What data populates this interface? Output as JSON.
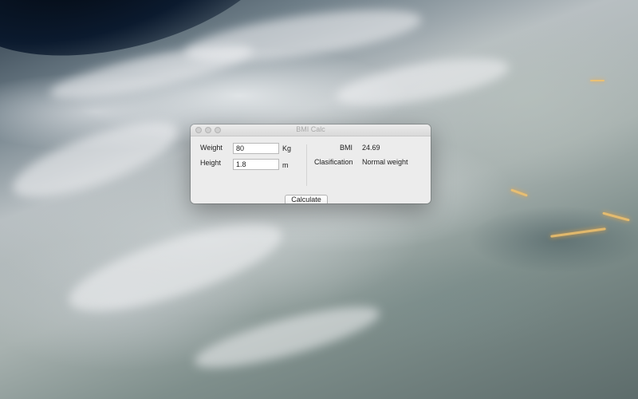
{
  "window": {
    "title": "BMI Calc"
  },
  "form": {
    "weight_label": "Weight",
    "weight_value": "80",
    "weight_unit": "Kg",
    "height_label": "Height",
    "height_value": "1.8",
    "height_unit": "m"
  },
  "results": {
    "bmi_label": "BMI",
    "bmi_value": "24.69",
    "classification_label": "Clasification",
    "classification_value": "Normal weight"
  },
  "actions": {
    "calculate_label": "Calculate"
  },
  "icons": {
    "window_controls": [
      "close-icon",
      "minimize-icon",
      "zoom-icon"
    ]
  },
  "colors": {
    "window_bg": "#ececec",
    "title_text": "#a9a9a9"
  }
}
